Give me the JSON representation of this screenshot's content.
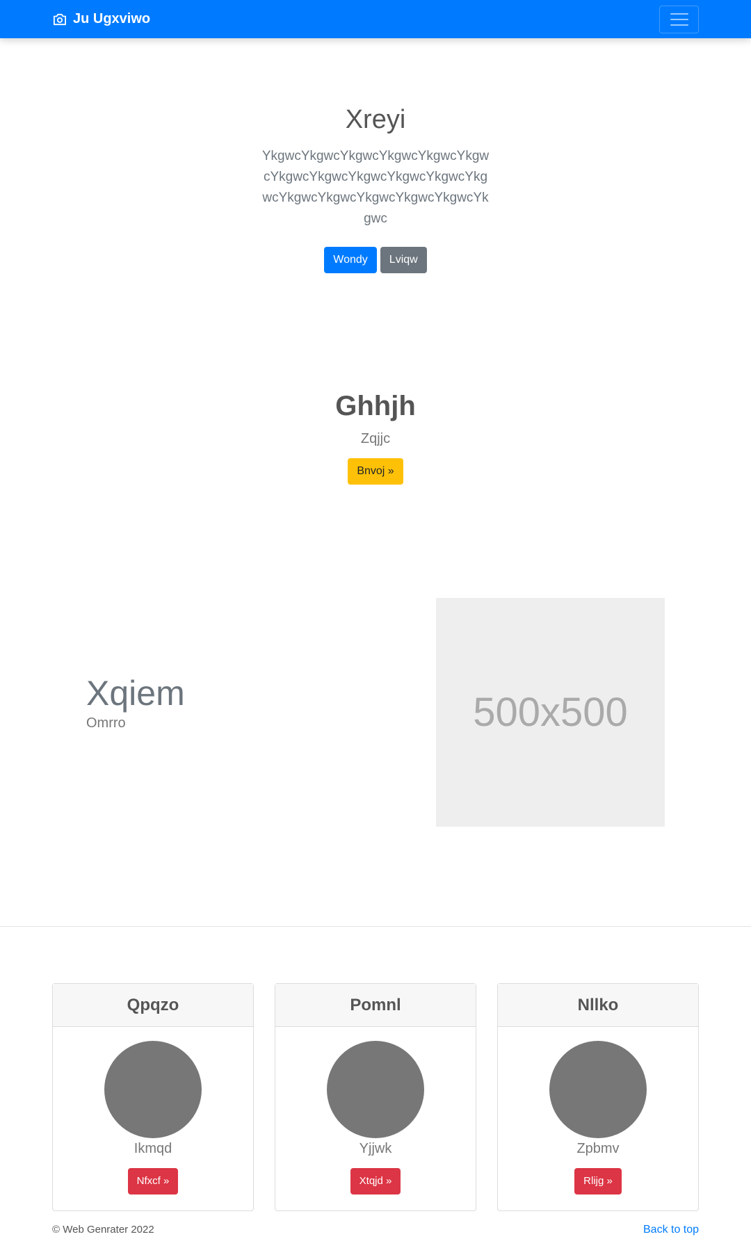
{
  "navbar": {
    "brand": "Ju Ugxviwo",
    "brand_icon": "camera-icon",
    "toggler_icon": "hamburger-icon",
    "bg_color": "#007bff"
  },
  "hero": {
    "title": "Xreyi",
    "lead": "YkgwcYkgwcYkgwcYkgwcYkgwcYkgwcYkgwcYkgwcYkgwcYkgwcYkgwcYkgwcYkgwcYkgwcYkgwcYkgwcYkgwcYkgwc",
    "primary_button": "Wondy",
    "secondary_button": "Lviqw"
  },
  "section2": {
    "title": "Ghhjh",
    "subtitle": "Zqjjc",
    "button": "Bnvoj »"
  },
  "feature": {
    "title": "Xqiem",
    "subtitle": "Omrro",
    "image_placeholder": "500x500"
  },
  "cards": [
    {
      "title": "Qpqzo",
      "name": "Ikmqd",
      "button": "Nfxcf »"
    },
    {
      "title": "Pomnl",
      "name": "Yjjwk",
      "button": "Xtqjd »"
    },
    {
      "title": "Nllko",
      "name": "Zpbmv",
      "button": "Rlijg »"
    }
  ],
  "footer": {
    "copyright": "© Web Genrater 2022",
    "back_to_top": "Back to top"
  },
  "colors": {
    "primary": "#007bff",
    "secondary": "#6c757d",
    "warning": "#ffc107",
    "danger": "#dc3545"
  }
}
